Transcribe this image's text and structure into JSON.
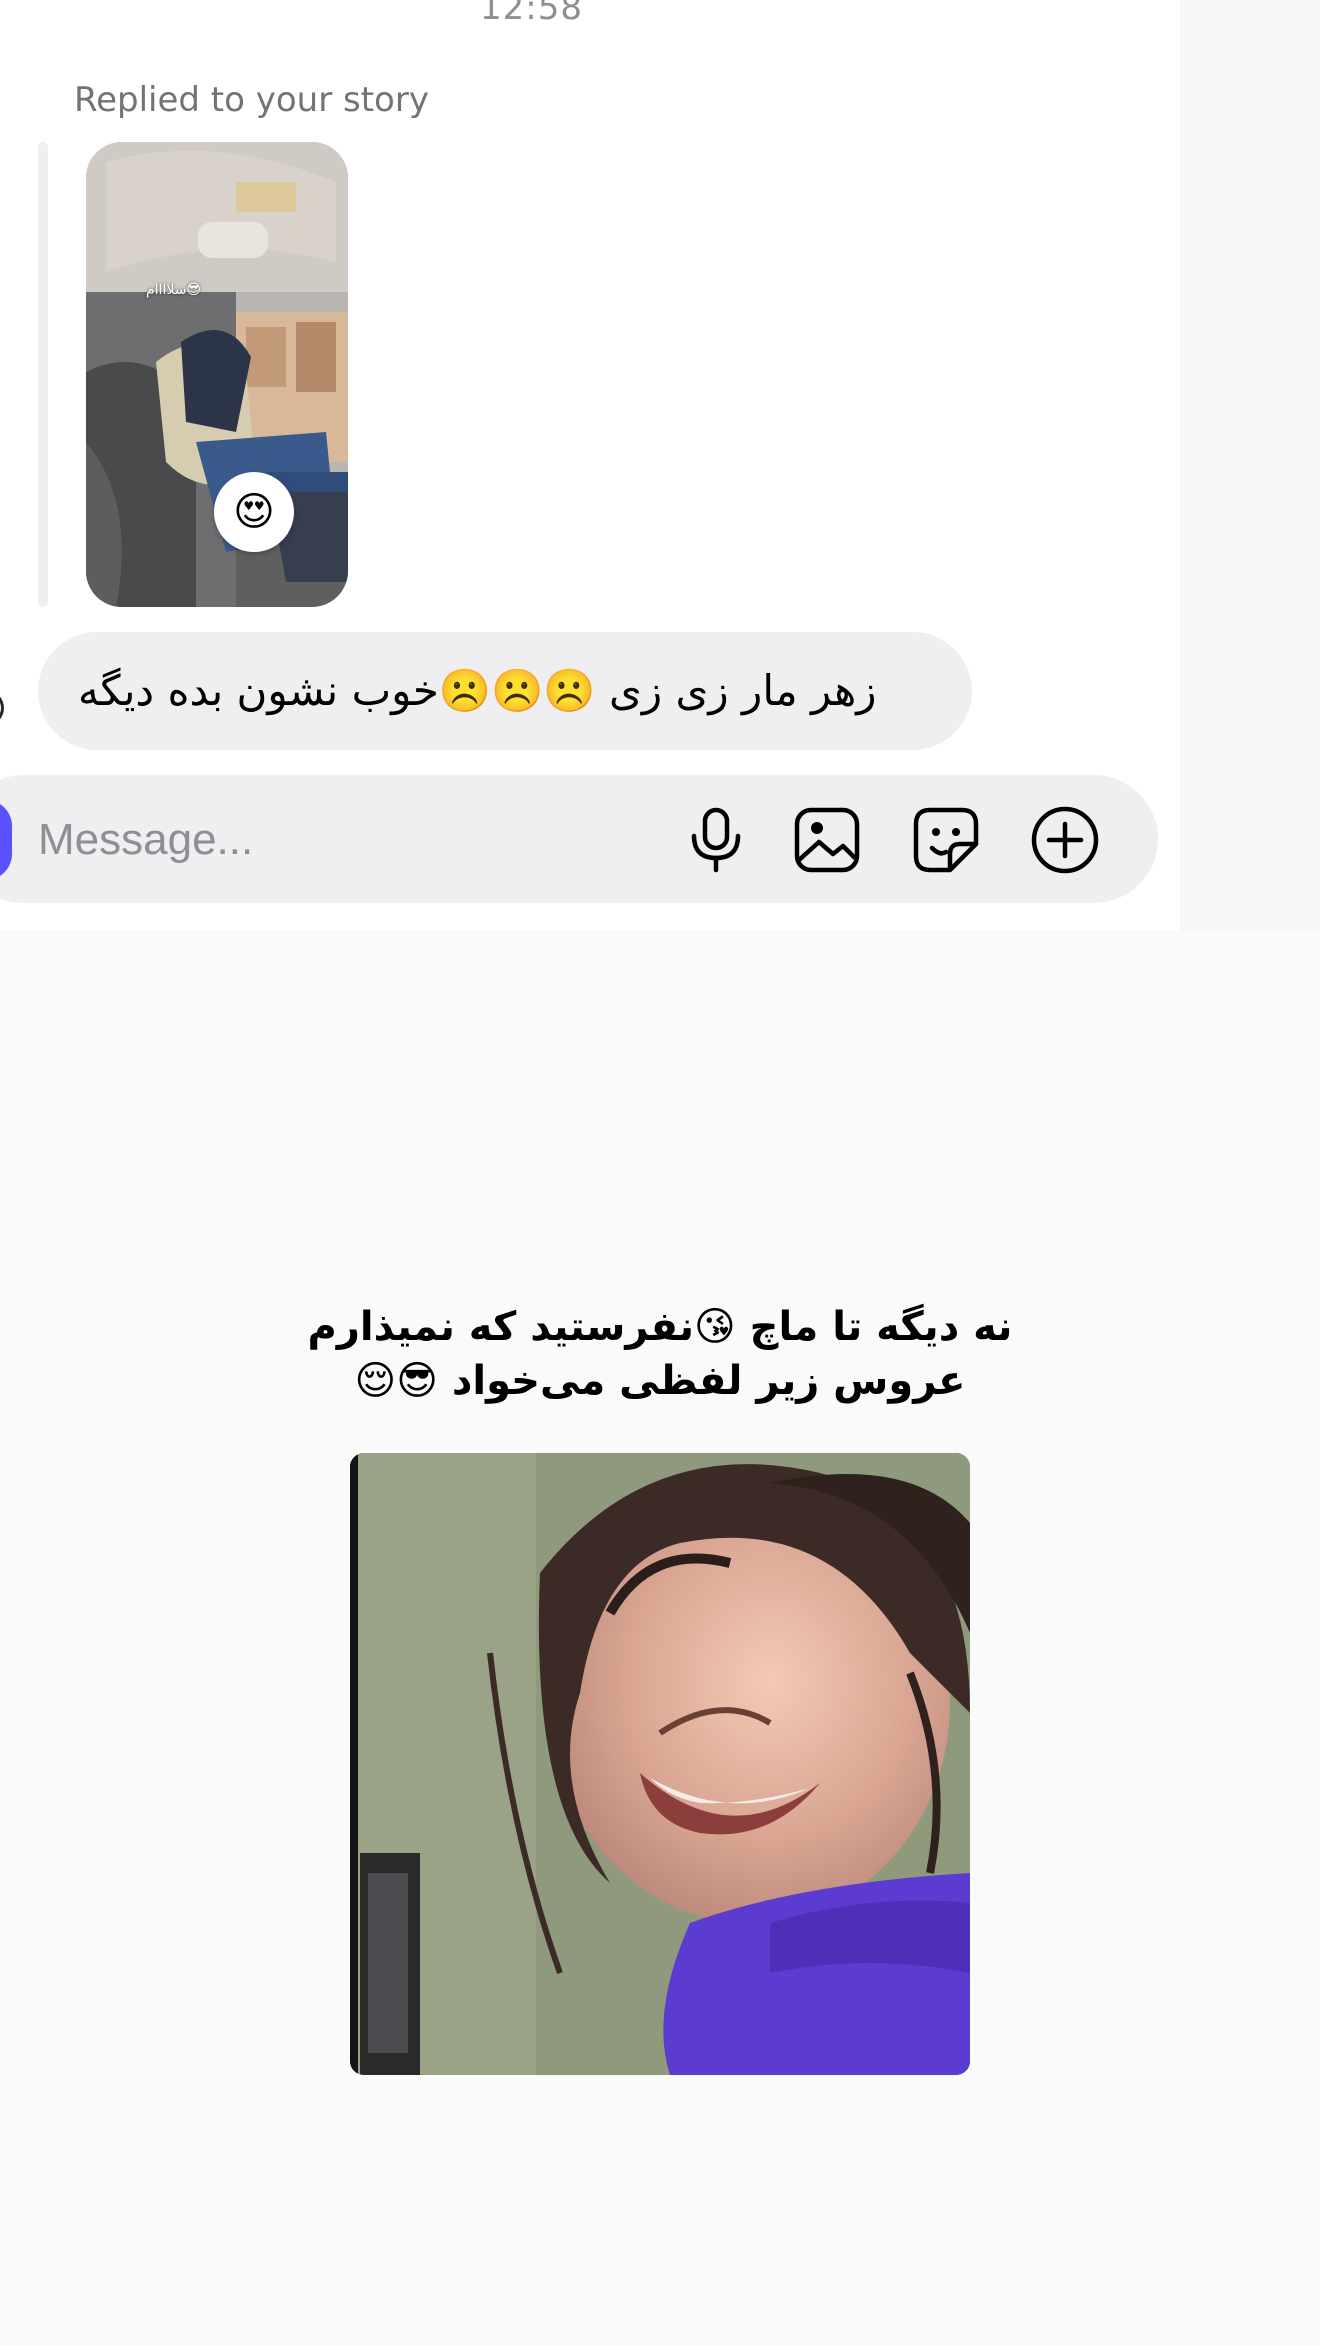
{
  "chat": {
    "timestamp": "12:58",
    "reply_label": "Replied to your story",
    "story": {
      "caption": "سلاااام😎",
      "reaction": "😍"
    },
    "message": "زهر مار زی زی ☹️☹️☹️خوب نشون بده دیگه"
  },
  "composer": {
    "placeholder": "Message...",
    "icons": [
      "microphone-icon",
      "image-icon",
      "sticker-icon",
      "plus-circle-icon"
    ],
    "accent_color": "#5b51ff"
  },
  "meme": {
    "caption_line1": "نه دیگه تا ماچ 😘نفرستید که نمیذارم",
    "caption_line2": "عروس زیر لفظی می‌خواد 😎😌"
  }
}
